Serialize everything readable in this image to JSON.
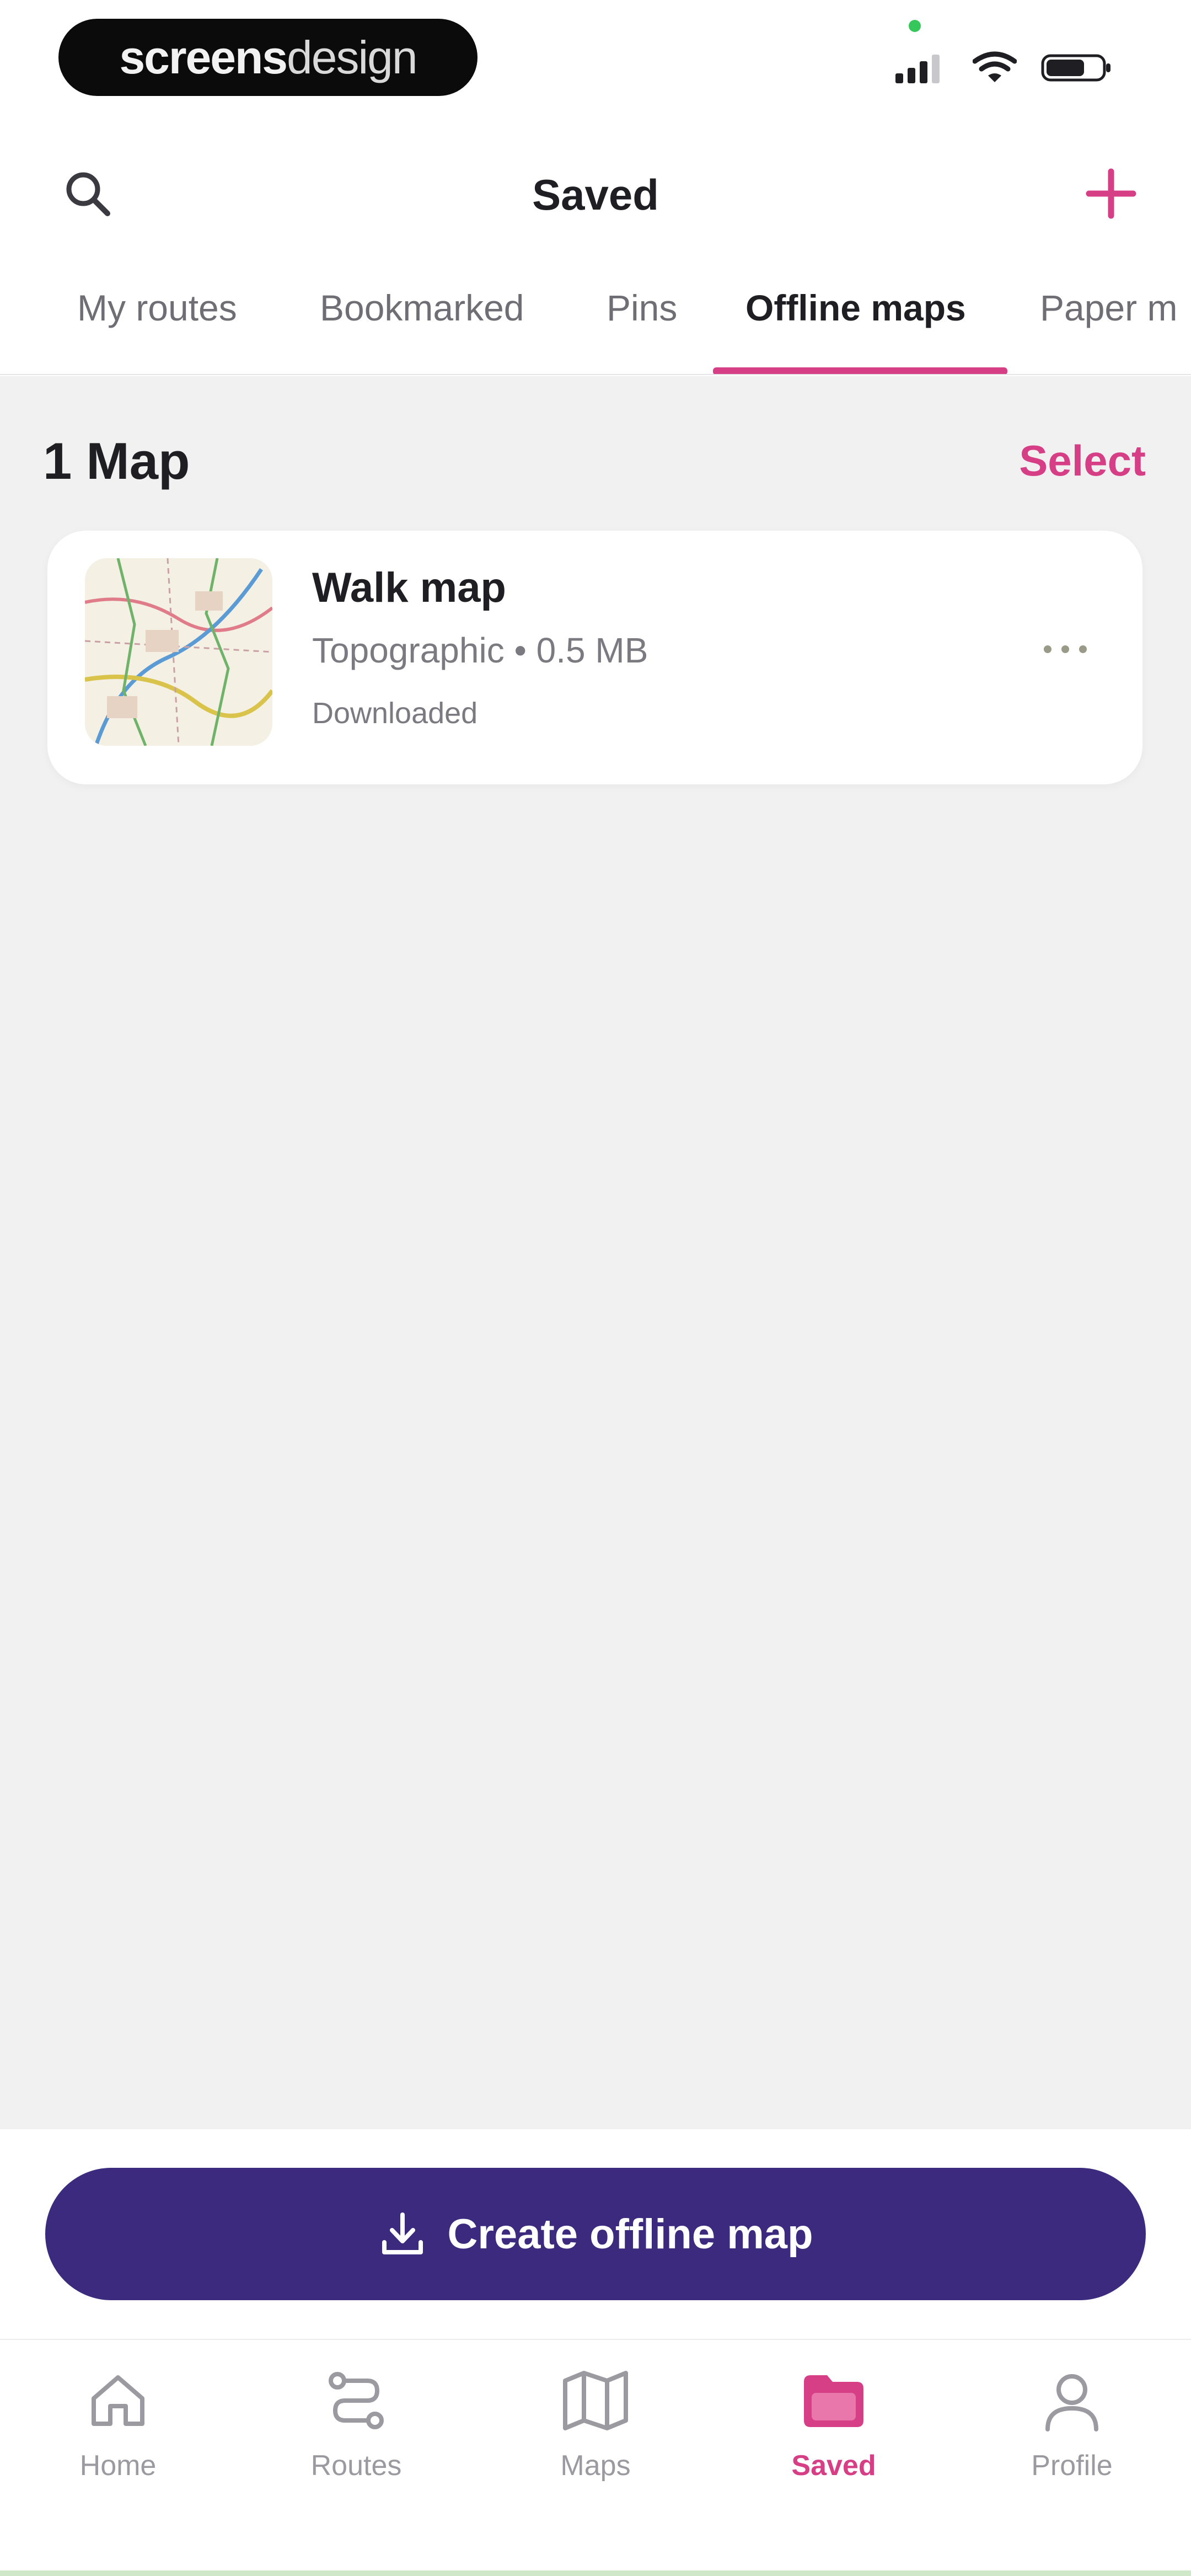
{
  "brand": {
    "bold": "screens",
    "light": "design"
  },
  "header": {
    "title": "Saved"
  },
  "tabs": [
    {
      "label": "My routes"
    },
    {
      "label": "Bookmarked"
    },
    {
      "label": "Pins"
    },
    {
      "label": "Offline maps",
      "active": true
    },
    {
      "label": "Paper m"
    }
  ],
  "content": {
    "count_title": "1 Map",
    "select_label": "Select"
  },
  "map_card": {
    "title": "Walk map",
    "meta": "Topographic • 0.5 MB",
    "status": "Downloaded"
  },
  "cta": {
    "label": "Create offline map"
  },
  "bottom_nav": [
    {
      "label": "Home",
      "icon": "home-icon"
    },
    {
      "label": "Routes",
      "icon": "routes-icon"
    },
    {
      "label": "Maps",
      "icon": "map-icon"
    },
    {
      "label": "Saved",
      "icon": "folder-icon",
      "active": true
    },
    {
      "label": "Profile",
      "icon": "profile-icon"
    }
  ],
  "colors": {
    "accent": "#d63f86",
    "primary_button": "#3c2a7f",
    "background": "#f1f1f1"
  }
}
